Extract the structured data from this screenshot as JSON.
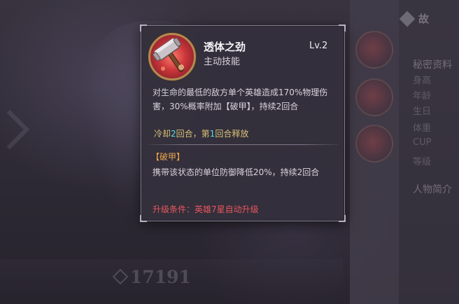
{
  "background": {
    "power_value": "17191",
    "side_header": "故",
    "side_section_1": "秘密资料",
    "side_rows": [
      "身高",
      "年龄",
      "生日",
      "体重",
      "CUP",
      "等级"
    ],
    "side_section_2": "人物简介"
  },
  "tooltip": {
    "skill_name": "透体之劲",
    "skill_type": "主动技能",
    "skill_level": "Lv.2",
    "description": "对生命的最低的敌方单个英雄造成170%物理伤害，30%概率附加【破甲】，持续2回合",
    "cooldown": {
      "prefix": "冷却",
      "cd_turns": "2",
      "middle": "回合，第",
      "release_turn": "1",
      "suffix": "回合释放"
    },
    "buff_title": "【破甲】",
    "buff_description": "携带该状态的单位防御降低20%，持续2回合",
    "upgrade_condition": "升级条件：英雄7星自动升级"
  },
  "colors": {
    "cooldown_text": "#d9c277",
    "cooldown_number": "#4fe0e6",
    "buff_title": "#e9a44c",
    "upgrade_text": "#e7575d"
  },
  "icons": {
    "skill": "hammer-icon"
  }
}
